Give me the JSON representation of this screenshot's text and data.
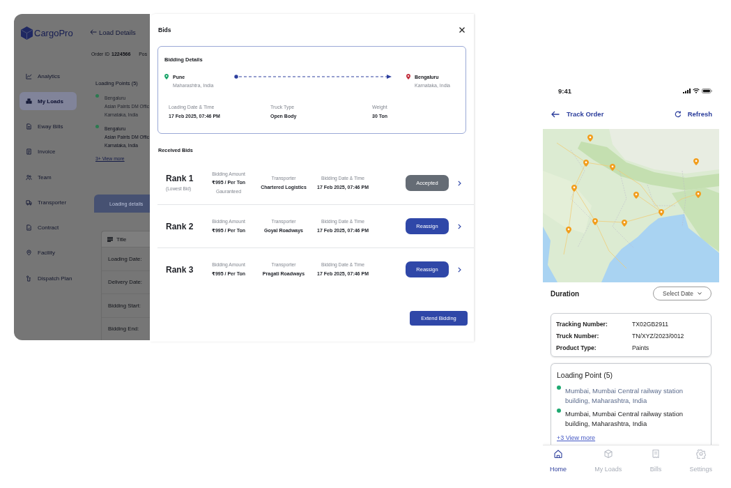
{
  "background_app": {
    "brand": "CargoPro",
    "page_title": "Load Details",
    "order": {
      "label": "Order ID",
      "value": "1224566",
      "next_label": "Pos"
    },
    "sidebar": [
      {
        "label": "Analytics",
        "selected": false
      },
      {
        "label": "My Loads",
        "selected": true
      },
      {
        "label": "Eway Bills",
        "selected": false
      },
      {
        "label": "Invoice",
        "selected": false
      },
      {
        "label": "Team",
        "selected": false
      },
      {
        "label": "Transporter",
        "selected": false
      },
      {
        "label": "Contract",
        "selected": false
      },
      {
        "label": "Facility",
        "selected": false
      },
      {
        "label": "Dispatch Plan",
        "selected": false
      }
    ],
    "loading_points": {
      "title": "Loading Points (5)",
      "points": [
        {
          "lines": [
            "Bengaluru",
            "Asian Paints DM Offic",
            "Karnataka, India"
          ],
          "dimmed": true
        },
        {
          "lines": [
            "Bengaluru",
            "Asian Paints DM Offic",
            "Karnataka, India"
          ],
          "dimmed": false
        }
      ],
      "view_more": "3+ View more"
    },
    "tabs": [
      {
        "label": "Loading details",
        "selected": true
      }
    ],
    "details_table": {
      "header": "Title",
      "rows": [
        "Loading Date:",
        "Delivery Date:",
        "Bidding Start:",
        "Bidding End:"
      ]
    }
  },
  "bids_panel": {
    "title": "Bids",
    "bidding_details": {
      "title": "Bidding Details",
      "origin": {
        "city": "Pune",
        "region": "Maharashtra, India"
      },
      "destination": {
        "city": "Bengaluru",
        "region": "Karnataka, India"
      },
      "fields": [
        {
          "label": "Loading Date & Time",
          "value": "17 Feb 2025, 07:46 PM"
        },
        {
          "label": "Truck Type",
          "value": "Open Body"
        },
        {
          "label": "Weight",
          "value": "30 Ton"
        }
      ]
    },
    "received_bids": {
      "title": "Received Bids",
      "bids": [
        {
          "rank": "Rank 1",
          "rank_note": "(Lowest Bid)",
          "amount_label": "Bidding Amount",
          "amount": "₹995 / Per Ton",
          "amount_note": "Gauranteed",
          "transporter_label": "Transporter",
          "transporter": "Chartered Logistics",
          "date_label": "Bidding Date & Time",
          "date": "17 Feb 2025, 07:46 PM",
          "action": {
            "label": "Accepted",
            "disabled": true
          }
        },
        {
          "rank": "Rank 2",
          "amount_label": "Bidding Amount",
          "amount": "₹995 / Per Ton",
          "transporter_label": "Transporter",
          "transporter": "Goyal Roadways",
          "date_label": "Bidding Date & Time",
          "date": "17 Feb 2025, 07:46 PM",
          "action": {
            "label": "Reassign",
            "disabled": false
          }
        },
        {
          "rank": "Rank 3",
          "amount_label": "Bidding Amount",
          "amount": "₹995 / Per Ton",
          "transporter_label": "Transporter",
          "transporter": "Pragati Roadways",
          "date_label": "Bidding Date & Time",
          "date": "17 Feb 2025, 07:46 PM",
          "action": {
            "label": "Reassign",
            "disabled": false
          }
        }
      ]
    },
    "extend_button": "Extend Bidding"
  },
  "phone": {
    "status_bar": {
      "time": "9:41"
    },
    "header": {
      "back_title": "Track Order",
      "action": "Refresh"
    },
    "duration": {
      "label": "Duration",
      "date_select": "Select Date"
    },
    "tracking_info": [
      {
        "label": "Tracking Number:",
        "value": "TX02GB2911"
      },
      {
        "label": "Truck Number:",
        "value": "TN/XYZ/2023/0012"
      },
      {
        "label": "Product Type:",
        "value": "Paints"
      }
    ],
    "loading_points": {
      "title": "Loading Point (5)",
      "points": [
        {
          "text": "Mumbai, Mumbai Central railway station building, Maharashtra, India",
          "dimmed": true
        },
        {
          "text": "Mumbai, Mumbai Central railway station building, Maharashtra, India",
          "dimmed": false
        }
      ],
      "view_more": "+3 View more"
    },
    "bottom_nav": [
      {
        "label": "Home",
        "selected": true
      },
      {
        "label": "My Loads",
        "selected": false
      },
      {
        "label": "Bills",
        "selected": false
      },
      {
        "label": "Settings",
        "selected": false
      }
    ]
  }
}
